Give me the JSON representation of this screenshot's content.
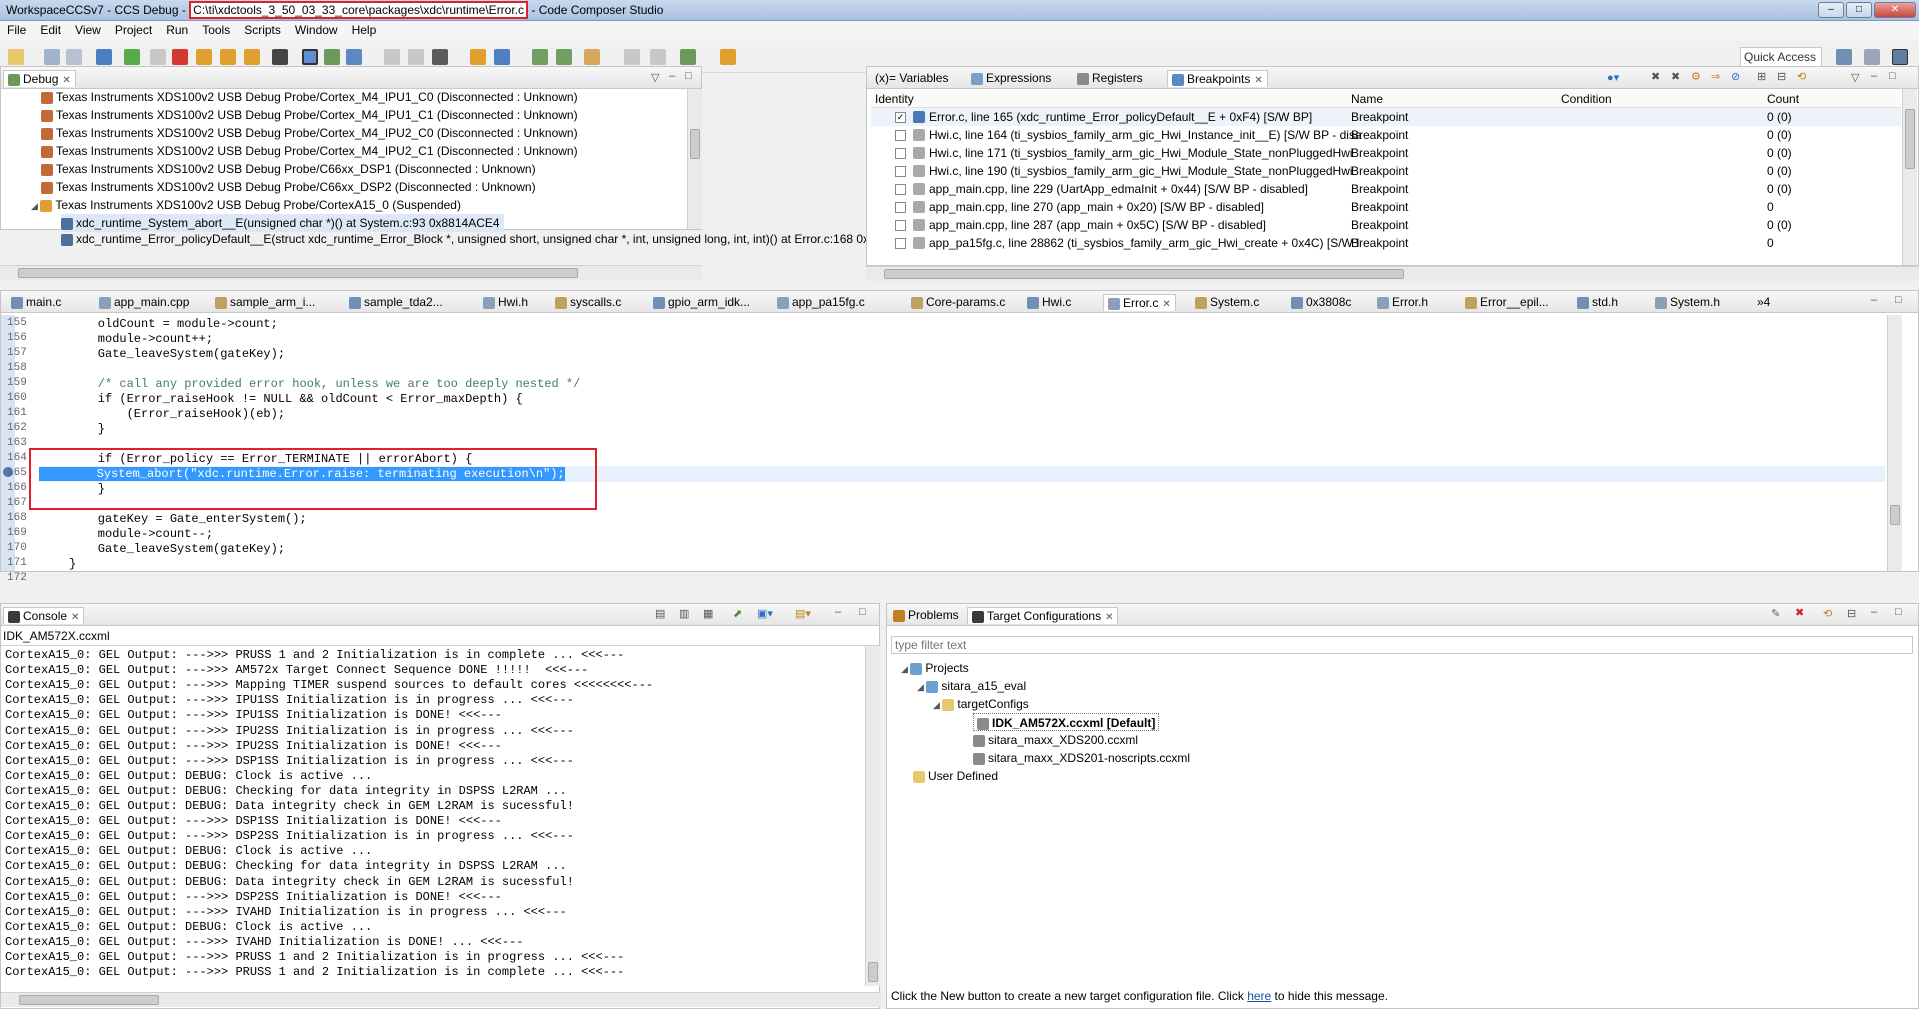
{
  "window": {
    "title_prefix": "WorkspaceCCSv7 - CCS Debug - ",
    "title_path": "C:\\ti\\xdctools_3_50_03_33_core\\packages\\xdc\\runtime\\Error.c",
    "title_suffix": " - Code Composer Studio",
    "minimize": "–",
    "maximize": "□",
    "close": "✕"
  },
  "menu": [
    "File",
    "Edit",
    "View",
    "Project",
    "Run",
    "Tools",
    "Scripts",
    "Window",
    "Help"
  ],
  "toolbar": {
    "quick_access": "Quick Access"
  },
  "debug": {
    "tab": "Debug",
    "items": [
      "Texas Instruments XDS100v2 USB Debug Probe/Cortex_M4_IPU1_C0 (Disconnected : Unknown)",
      "Texas Instruments XDS100v2 USB Debug Probe/Cortex_M4_IPU1_C1 (Disconnected : Unknown)",
      "Texas Instruments XDS100v2 USB Debug Probe/Cortex_M4_IPU2_C0 (Disconnected : Unknown)",
      "Texas Instruments XDS100v2 USB Debug Probe/Cortex_M4_IPU2_C1 (Disconnected : Unknown)",
      "Texas Instruments XDS100v2 USB Debug Probe/C66xx_DSP1 (Disconnected : Unknown)",
      "Texas Instruments XDS100v2 USB Debug Probe/C66xx_DSP2 (Disconnected : Unknown)",
      "Texas Instruments XDS100v2 USB Debug Probe/CortexA15_0 (Suspended)"
    ],
    "frames": [
      "xdc_runtime_System_abort__E(unsigned char *)() at System.c:93 0x8814ACE4",
      "xdc_runtime_Error_policyDefault__E(struct xdc_runtime_Error_Block *, unsigned short, unsigned char *, int, unsigned long, int, int)() at Error.c:168 0x"
    ]
  },
  "bp_panel": {
    "tabs": [
      "(x)= Variables",
      "Expressions",
      "Registers",
      "Breakpoints"
    ],
    "columns": [
      "Identity",
      "Name",
      "Condition",
      "Count"
    ],
    "rows": [
      {
        "checked": true,
        "identity": "Error.c, line 165 (xdc_runtime_Error_policyDefault__E + 0xF4)  [S/W BP]",
        "name": "Breakpoint",
        "condition": "",
        "count": "0 (0)"
      },
      {
        "checked": false,
        "identity": "Hwi.c, line 164 (ti_sysbios_family_arm_gic_Hwi_Instance_init__E)  [S/W BP - disa",
        "name": "Breakpoint",
        "condition": "",
        "count": "0 (0)"
      },
      {
        "checked": false,
        "identity": "Hwi.c, line 171 (ti_sysbios_family_arm_gic_Hwi_Module_State_nonPluggedHwi",
        "name": "Breakpoint",
        "condition": "",
        "count": "0 (0)"
      },
      {
        "checked": false,
        "identity": "Hwi.c, line 190 (ti_sysbios_family_arm_gic_Hwi_Module_State_nonPluggedHwi",
        "name": "Breakpoint",
        "condition": "",
        "count": "0 (0)"
      },
      {
        "checked": false,
        "identity": "app_main.cpp, line 229 (UartApp_edmaInit + 0x44)  [S/W BP - disabled]",
        "name": "Breakpoint",
        "condition": "",
        "count": "0 (0)"
      },
      {
        "checked": false,
        "identity": "app_main.cpp, line 270 (app_main + 0x20)  [S/W BP - disabled]",
        "name": "Breakpoint",
        "condition": "",
        "count": "0"
      },
      {
        "checked": false,
        "identity": "app_main.cpp, line 287 (app_main + 0x5C)  [S/W BP - disabled]",
        "name": "Breakpoint",
        "condition": "",
        "count": "0 (0)"
      },
      {
        "checked": false,
        "identity": "app_pa15fg.c, line 28862 (ti_sysbios_family_arm_gic_Hwi_create + 0x4C)  [S/W I",
        "name": "Breakpoint",
        "condition": "",
        "count": "0"
      }
    ]
  },
  "editor": {
    "tabs": [
      "main.c",
      "app_main.cpp",
      "sample_arm_i...",
      "sample_tda2...",
      "Hwi.h",
      "syscalls.c",
      "gpio_arm_idk...",
      "app_pa15fg.c",
      "Core-params.c",
      "Hwi.c",
      "Error.c",
      "System.c",
      "0x3808c",
      "Error.h",
      "Error__epil...",
      "std.h",
      "System.h",
      "»4"
    ],
    "lines": [
      {
        "n": "155",
        "t": "    oldCount = module->count;"
      },
      {
        "n": "156",
        "t": "    module->count++;"
      },
      {
        "n": "157",
        "t": "    Gate_leaveSystem(gateKey);"
      },
      {
        "n": "158",
        "t": ""
      },
      {
        "n": "159",
        "t": "    /* call any provided error hook, unless we are too deeply nested */",
        "cm": true
      },
      {
        "n": "160",
        "t": "    if (Error_raiseHook != NULL && oldCount < Error_maxDepth) {"
      },
      {
        "n": "161",
        "t": "        (Error_raiseHook)(eb);"
      },
      {
        "n": "162",
        "t": "    }"
      },
      {
        "n": "163",
        "t": ""
      },
      {
        "n": "164",
        "t": "    if (Error_policy == Error_TERMINATE || errorAbort) {"
      },
      {
        "n": "165",
        "t": "        System_abort(\"xdc.runtime.Error.raise: terminating execution\\n\");",
        "sel": true
      },
      {
        "n": "166",
        "t": "    }"
      },
      {
        "n": "167",
        "t": ""
      },
      {
        "n": "168",
        "t": "    gateKey = Gate_enterSystem();"
      },
      {
        "n": "169",
        "t": "    module->count--;"
      },
      {
        "n": "170",
        "t": "    Gate_leaveSystem(gateKey);"
      },
      {
        "n": "171",
        "t": "}"
      },
      {
        "n": "172",
        "t": ""
      }
    ]
  },
  "console": {
    "tab": "Console",
    "config": "IDK_AM572X.ccxml",
    "lines": [
      "CortexA15_0: GEL Output: --->>> PRUSS 1 and 2 Initialization is in complete ... <<<---",
      "CortexA15_0: GEL Output: --->>> AM572x Target Connect Sequence DONE !!!!!  <<<---",
      "CortexA15_0: GEL Output: --->>> Mapping TIMER suspend sources to default cores <<<<<<<<---",
      "CortexA15_0: GEL Output: --->>> IPU1SS Initialization is in progress ... <<<---",
      "CortexA15_0: GEL Output: --->>> IPU1SS Initialization is DONE! <<<---",
      "CortexA15_0: GEL Output: --->>> IPU2SS Initialization is in progress ... <<<---",
      "CortexA15_0: GEL Output: --->>> IPU2SS Initialization is DONE! <<<---",
      "CortexA15_0: GEL Output: --->>> DSP1SS Initialization is in progress ... <<<---",
      "CortexA15_0: GEL Output: DEBUG: Clock is active ...",
      "CortexA15_0: GEL Output: DEBUG: Checking for data integrity in DSPSS L2RAM ...",
      "CortexA15_0: GEL Output: DEBUG: Data integrity check in GEM L2RAM is sucessful!",
      "CortexA15_0: GEL Output: --->>> DSP1SS Initialization is DONE! <<<---",
      "CortexA15_0: GEL Output: --->>> DSP2SS Initialization is in progress ... <<<---",
      "CortexA15_0: GEL Output: DEBUG: Clock is active ...",
      "CortexA15_0: GEL Output: DEBUG: Checking for data integrity in DSPSS L2RAM ...",
      "CortexA15_0: GEL Output: DEBUG: Data integrity check in GEM L2RAM is sucessful!",
      "CortexA15_0: GEL Output: --->>> DSP2SS Initialization is DONE! <<<---",
      "CortexA15_0: GEL Output: --->>> IVAHD Initialization is in progress ... <<<---",
      "CortexA15_0: GEL Output: DEBUG: Clock is active ...",
      "CortexA15_0: GEL Output: --->>> IVAHD Initialization is DONE! ... <<<---",
      "CortexA15_0: GEL Output: --->>> PRUSS 1 and 2 Initialization is in progress ... <<<---",
      "CortexA15_0: GEL Output: --->>> PRUSS 1 and 2 Initialization is in complete ... <<<---"
    ]
  },
  "targets": {
    "tabs": [
      "Problems",
      "Target Configurations"
    ],
    "filter_placeholder": "type filter text",
    "tree": {
      "projects": "Projects",
      "project": "sitara_a15_eval",
      "folder": "targetConfigs",
      "files": [
        "IDK_AM572X.ccxml [Default]",
        "sitara_maxx_XDS200.ccxml",
        "sitara_maxx_XDS201-noscripts.ccxml"
      ],
      "user_defined": "User Defined"
    },
    "hint_before": "Click the New button to create a new target configuration file. Click ",
    "hint_link": "here",
    "hint_after": " to hide this message."
  }
}
